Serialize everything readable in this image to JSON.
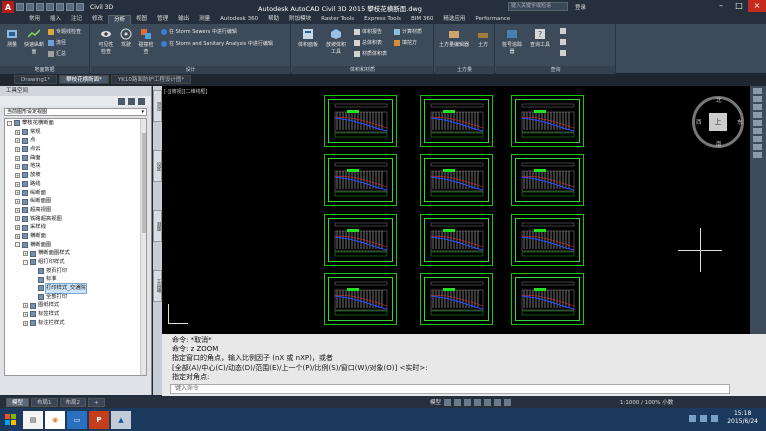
{
  "titlebar": {
    "workspace": "Civil 3D",
    "title": "Autodesk AutoCAD Civil 3D 2015    攀枝花横断面.dwg",
    "search_placeholder": "键入关键字或短语",
    "user": "登录"
  },
  "menu_tabs": [
    "常用",
    "插入",
    "注记",
    "修改",
    "分析",
    "视图",
    "管理",
    "输出",
    "测量",
    "Autodesk 360",
    "帮助",
    "附加模块",
    "Raster Tools",
    "Express Tools",
    "BIM 360",
    "精选应用",
    "Performance"
  ],
  "active_menu_tab": "分析",
  "ribbon": {
    "groups": [
      {
        "title": "地面数据"
      },
      {
        "title": "设计"
      },
      {
        "title": "体积和材质"
      },
      {
        "title": "土方量"
      },
      {
        "title": "查询"
      }
    ],
    "buttons": {
      "survey": "测量",
      "quick_profile": "快速纵断面",
      "watershed": "流域",
      "drawing_check": "专题线检查",
      "flow_paths": "流径",
      "summary": "汇总",
      "visibility": "可见性检查",
      "drive": "驾驶",
      "collision": "碰撞检查",
      "storm_sewers": "在 Storm Sewers 中进行编辑",
      "storm_sanitary": "在 Storm and Sanitary Analysis 中进行编辑",
      "volume_panel": "体积面板",
      "mass_haul": "放坡体积工具",
      "volume_report": "体积报告",
      "total_volume": "总体积表",
      "material_volume": "材质体积表",
      "calc_material": "计算材质",
      "fill_tool": "填挖方",
      "earthwork": "土方量编辑器",
      "earthwork2": "土方",
      "station_tracker": "桩号追踪器",
      "query_tool": "查询工具"
    }
  },
  "doc_tabs": [
    "Drawing1*",
    "攀枝花横断面*",
    "YK10路面防护工程设计图*"
  ],
  "active_doc_tab": "攀枝花横断面*",
  "toolspace": {
    "title": "工具空间",
    "combo": "当前图形设定视图",
    "tree": [
      {
        "label": "攀枝花横断面",
        "level": 0,
        "exp": "-"
      },
      {
        "label": "常规",
        "level": 1,
        "exp": "+"
      },
      {
        "label": "点",
        "level": 1,
        "exp": "+"
      },
      {
        "label": "点云",
        "level": 1,
        "exp": "+"
      },
      {
        "label": "曲面",
        "level": 1,
        "exp": "+"
      },
      {
        "label": "地块",
        "level": 1,
        "exp": "+"
      },
      {
        "label": "放坡",
        "level": 1,
        "exp": "+"
      },
      {
        "label": "路线",
        "level": 1,
        "exp": "+"
      },
      {
        "label": "纵断面",
        "level": 1,
        "exp": "+"
      },
      {
        "label": "纵断面图",
        "level": 1,
        "exp": "+"
      },
      {
        "label": "超高视图",
        "level": 1,
        "exp": "+"
      },
      {
        "label": "铁路超高视图",
        "level": 1,
        "exp": "+"
      },
      {
        "label": "采样线",
        "level": 1,
        "exp": "+"
      },
      {
        "label": "横断面",
        "level": 1,
        "exp": "+"
      },
      {
        "label": "横断面图",
        "level": 1,
        "exp": "-"
      },
      {
        "label": "横断面图样式",
        "level": 2,
        "exp": "+"
      },
      {
        "label": "组打印样式",
        "level": 2,
        "exp": "-"
      },
      {
        "label": "按页打印",
        "level": 3,
        "exp": ""
      },
      {
        "label": "标准",
        "level": 3,
        "exp": ""
      },
      {
        "label": "打印样式_交通院",
        "level": 3,
        "exp": "",
        "selected": true
      },
      {
        "label": "全部打印",
        "level": 3,
        "exp": ""
      },
      {
        "label": "图纸样式",
        "level": 2,
        "exp": "+"
      },
      {
        "label": "标签样式",
        "level": 2,
        "exp": "+"
      },
      {
        "label": "标注栏样式",
        "level": 2,
        "exp": "+"
      }
    ],
    "side_tabs": [
      "浏览",
      "设定",
      "测量",
      "工具箱"
    ]
  },
  "canvas": {
    "viewport_label": "[-][俯视][二维线框]",
    "viewcube_face": "上",
    "compass": {
      "n": "北",
      "s": "南",
      "e": "东",
      "w": "西"
    },
    "sheet_rows": 4,
    "sheet_cols": 3
  },
  "command": {
    "lines": [
      "命令: *取消*",
      "命令: z ZOOM",
      "指定窗口的角点，输入比例因子 (nX 或 nXP)，或者",
      "[全部(A)/中心(C)/动态(D)/范围(E)/上一个(P)/比例(S)/窗口(W)/对象(O)] <实时>:",
      "指定对角点:"
    ],
    "placeholder": "键入命令"
  },
  "layout_tabs": [
    "模型",
    "布局1",
    "布局2",
    "+"
  ],
  "active_layout_tab": "模型",
  "status": {
    "model_label": "模型",
    "scale": "1:1000 / 100%",
    "decimal": "小数"
  },
  "taskbar": {
    "time": "15:18",
    "date": "2015/6/24"
  }
}
